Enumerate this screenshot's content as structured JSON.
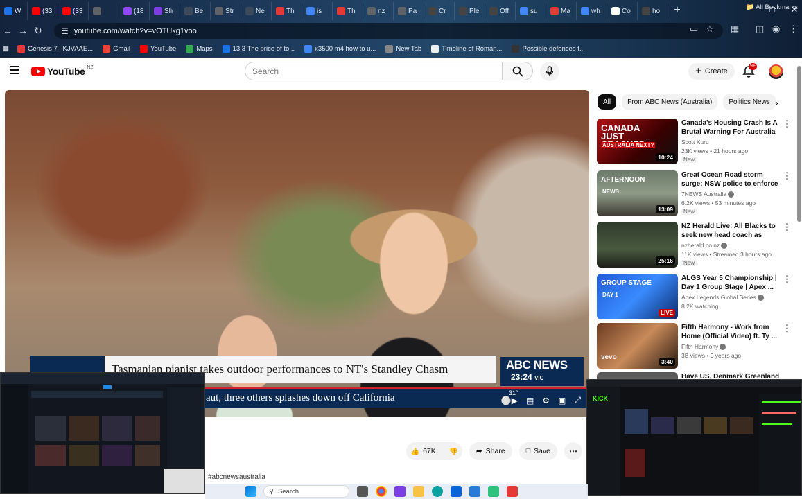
{
  "browser": {
    "tabs": [
      {
        "label": "W",
        "color": "#1a73e8"
      },
      {
        "label": "(33",
        "color": "#ff0000"
      },
      {
        "label": "(33",
        "color": "#ff0000"
      },
      {
        "label": "",
        "color": "#5f6368"
      },
      {
        "label": "(18",
        "color": "#9146ff"
      },
      {
        "label": "Sh",
        "color": "#7b3fe4"
      },
      {
        "label": "Be",
        "color": "#3d4a5c"
      },
      {
        "label": "Str",
        "color": "#5f6368"
      },
      {
        "label": "Ne",
        "color": "#3d4a5c"
      },
      {
        "label": "Th",
        "color": "#e53935"
      },
      {
        "label": "is",
        "color": "#4285f4"
      },
      {
        "label": "Th",
        "color": "#e53935"
      },
      {
        "label": "nz",
        "color": "#5f6368"
      },
      {
        "label": "Pa",
        "color": "#5f6368"
      },
      {
        "label": "Cr",
        "color": "#444"
      },
      {
        "label": "Ple",
        "color": "#444"
      },
      {
        "label": "Off",
        "color": "#444"
      },
      {
        "label": "su",
        "color": "#4285f4"
      },
      {
        "label": "Ma",
        "color": "#e53935"
      },
      {
        "label": "wh",
        "color": "#4285f4"
      },
      {
        "label": "Co",
        "color": "#fff"
      },
      {
        "label": "ho",
        "color": "#444"
      }
    ],
    "url": "youtube.com/watch?v=vOTUkg1voo",
    "bookmarks": [
      {
        "label": "Genesis 7 | KJVAAE...",
        "color": "#e53935"
      },
      {
        "label": "Gmail",
        "color": "#ea4335"
      },
      {
        "label": "YouTube",
        "color": "#ff0000"
      },
      {
        "label": "Maps",
        "color": "#34a853"
      },
      {
        "label": "13.3 The price of to...",
        "color": "#1a73e8"
      },
      {
        "label": "x3500 m4 how to u...",
        "color": "#4285f4"
      },
      {
        "label": "New Tab",
        "color": "#888"
      },
      {
        "label": "Timeline of Roman...",
        "color": "#eee"
      },
      {
        "label": "Possible defences t...",
        "color": "#333"
      }
    ],
    "all_bookmarks": "All Bookmarks"
  },
  "youtube": {
    "logo_text": "YouTube",
    "region": "NZ",
    "search_placeholder": "Search",
    "create_label": "Create",
    "notif_badge": "9+"
  },
  "video": {
    "lower_third_tag": "PIANO MAN",
    "lower_third_headline": "Tasmanian pianist takes outdoor performances to NT's Standley Chasm",
    "network": "ABC NEWS",
    "time": "23:24",
    "time_region": "VIC",
    "weather": "31°",
    "ticker": "aut, three others splashes down off California",
    "likes": "67K",
    "share": "Share",
    "save": "Save",
    "hashtag": "#abcnewsaustralia"
  },
  "chips": [
    "All",
    "From ABC News (Australia)",
    "Politics News"
  ],
  "recommendations": [
    {
      "title": "Canada's Housing Crash Is A Brutal Warning For Australia ...",
      "channel": "Scott Kuru",
      "verified": false,
      "meta": "23K views • 21 hours ago",
      "badge": "New",
      "duration": "10:24",
      "thumb_text": "CANADA JUST CRASHED",
      "thumb_sub": "AUSTRALIA NEXT?"
    },
    {
      "title": "Great Ocean Road storm surge; NSW police to enforce protest ...",
      "channel": "7NEWS Australia",
      "verified": true,
      "meta": "6.2K views • 53 minutes ago",
      "badge": "New",
      "duration": "13:09",
      "thumb_text": "AFTERNOON",
      "thumb_sub": "NEWS"
    },
    {
      "title": "NZ Herald Live: All Blacks to seek new head coach as Scott...",
      "channel": "nzherald.co.nz",
      "verified": true,
      "meta": "11K views • Streamed 3 hours ago",
      "badge": "New",
      "duration": "25:16",
      "thumb_text": "",
      "thumb_sub": ""
    },
    {
      "title": "ALGS Year 5 Championship | Day 1 Group Stage | Apex ...",
      "channel": "Apex Legends Global Series",
      "verified": true,
      "meta": "8.2K watching",
      "badge": "",
      "duration": "LIVE",
      "thumb_text": "GROUP STAGE",
      "thumb_sub": "DAY 1"
    },
    {
      "title": "Fifth Harmony - Work from Home (Official Video) ft. Ty ...",
      "channel": "Fifth Harmony",
      "verified": true,
      "meta": "3B views • 9 years ago",
      "badge": "",
      "duration": "3:40",
      "thumb_text": "vevo",
      "thumb_sub": ""
    },
    {
      "title": "Have US, Denmark Greenland ...",
      "channel": "",
      "verified": false,
      "meta": "",
      "badge": "",
      "duration": "",
      "thumb_text": "",
      "thumb_sub": ""
    }
  ],
  "taskbar": {
    "search_placeholder": "Search"
  },
  "pip_right": {
    "brand": "KICK"
  }
}
